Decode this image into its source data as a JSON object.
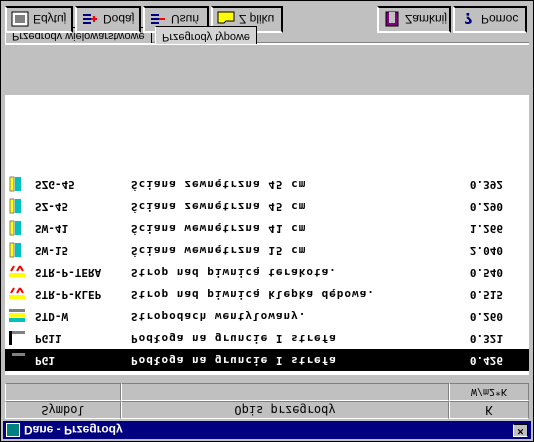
{
  "window": {
    "title": "Dane - Przegrody",
    "close_label": "×"
  },
  "toolbar": {
    "edit_label": "Edytuj",
    "add_label": "Dodaj",
    "delete_label": "Usuń",
    "file_label": "Z pliku",
    "close_label": "Zamknij",
    "help_label": "Pomoc"
  },
  "table": {
    "header_symbol": "Symbol",
    "header_desc": "Opis przegrody",
    "header_k": "K",
    "unit_k": "W/m2*K",
    "rows": [
      {
        "symbol": "PG1",
        "desc": "Podłoga na gruncie I strefa",
        "k": "0.426",
        "selected": true,
        "icon": "floor-icon"
      },
      {
        "symbol": "PG11",
        "desc": "Podłoga na gruncie I strefa",
        "k": "0.321",
        "icon": "floor-icon"
      },
      {
        "symbol": "STD-W",
        "desc": "Stropodach wentylowany.",
        "k": "0.260",
        "icon": "roof-icon"
      },
      {
        "symbol": "STR-P-KLEP",
        "desc": "Strop nad piwnicą klepka dębowa.",
        "k": "0.515",
        "icon": "ceiling-icon"
      },
      {
        "symbol": "STR-P-TERA",
        "desc": "Strop nad piwnicą terakota.",
        "k": "0.540",
        "icon": "ceiling-icon"
      },
      {
        "symbol": "SW-15",
        "desc": "Ściana wewnętrzna 15 cm",
        "k": "2.040",
        "icon": "wall-icon"
      },
      {
        "symbol": "SW-41",
        "desc": "Ściana wewnętrzna 41 cm",
        "k": "1.266",
        "icon": "wall-icon"
      },
      {
        "symbol": "SZ-45",
        "desc": "Ściana zewnętrzna 45 cm",
        "k": "0.290",
        "icon": "wall-icon"
      },
      {
        "symbol": "SZG-45",
        "desc": "Ściana zewnętrzna 45 cm",
        "k": "0.392",
        "icon": "wall-icon"
      }
    ]
  },
  "tabs": [
    {
      "label": "Przegrody wielowarstwowe",
      "active": false
    },
    {
      "label": "Przegrody typowe",
      "active": true
    }
  ],
  "colors": {
    "title_bg": "#000080",
    "face": "#c0c0c0",
    "selected": "#000000"
  }
}
